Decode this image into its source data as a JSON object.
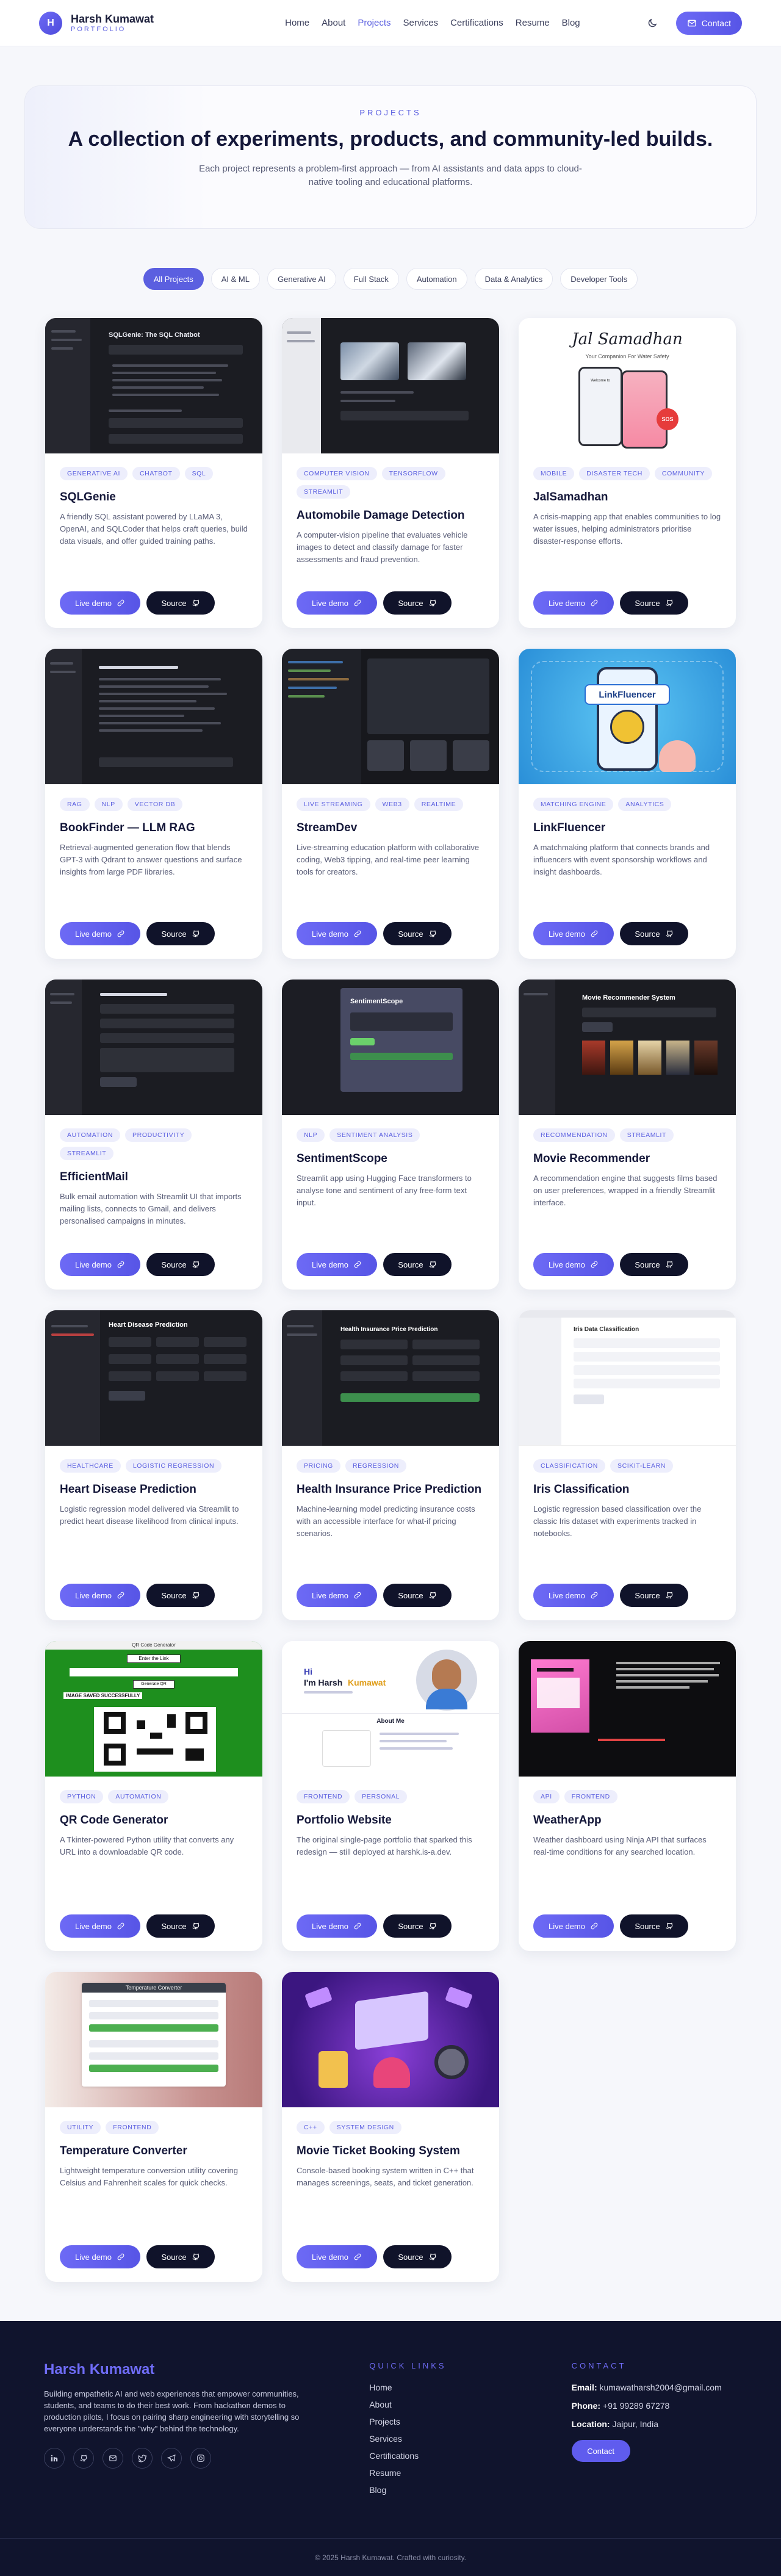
{
  "brand": {
    "logo": "H",
    "name": "Harsh Kumawat",
    "sub": "PORTFOLIO"
  },
  "nav": {
    "links": [
      "Home",
      "About",
      "Projects",
      "Services",
      "Certifications",
      "Resume",
      "Blog"
    ],
    "active": "Projects",
    "contact": "Contact"
  },
  "hero": {
    "eyebrow": "PROJECTS",
    "title": "A collection of experiments, products, and community-led builds.",
    "desc": "Each project represents a problem-first approach — from AI assistants and data apps to cloud-native tooling and educational platforms."
  },
  "filters": [
    "All Projects",
    "AI & ML",
    "Generative AI",
    "Full Stack",
    "Automation",
    "Data & Analytics",
    "Developer Tools"
  ],
  "buttons": {
    "live": "Live demo",
    "source": "Source"
  },
  "projects": [
    {
      "title": "SQLGenie",
      "tags": [
        "GENERATIVE AI",
        "CHATBOT",
        "SQL"
      ],
      "desc": "A friendly SQL assistant powered by LLaMA 3, OpenAI, and SQLCoder that helps craft queries, build data visuals, and offer guided training paths.",
      "thumb_text": "SQLGenie: The SQL Chatbot"
    },
    {
      "title": "Automobile Damage Detection",
      "tags": [
        "COMPUTER VISION",
        "TENSORFLOW",
        "STREAMLIT"
      ],
      "desc": "A computer-vision pipeline that evaluates vehicle images to detect and classify damage for faster assessments and fraud prevention."
    },
    {
      "title": "JalSamadhan",
      "tags": [
        "MOBILE",
        "DISASTER TECH",
        "COMMUNITY"
      ],
      "desc": "A crisis-mapping app that enables communities to log water issues, helping administrators prioritise disaster-response efforts.",
      "thumb_script": "Jal Samadhan",
      "thumb_sub": "Your Companion For Water Safety",
      "thumb_welcome": "Welcome to",
      "thumb_badge": "SOS"
    },
    {
      "title": "BookFinder — LLM RAG",
      "tags": [
        "RAG",
        "NLP",
        "VECTOR DB"
      ],
      "desc": "Retrieval-augmented generation flow that blends GPT-3 with Qdrant to answer questions and surface insights from large PDF libraries."
    },
    {
      "title": "StreamDev",
      "tags": [
        "LIVE STREAMING",
        "WEB3",
        "REALTIME"
      ],
      "desc": "Live-streaming education platform with collaborative coding, Web3 tipping, and real-time peer learning tools for creators."
    },
    {
      "title": "LinkFluencer",
      "tags": [
        "MATCHING ENGINE",
        "ANALYTICS"
      ],
      "desc": "A matchmaking platform that connects brands and influencers with event sponsorship workflows and insight dashboards.",
      "thumb_text": "LinkFluencer"
    },
    {
      "title": "EfficientMail",
      "tags": [
        "AUTOMATION",
        "PRODUCTIVITY",
        "STREAMLIT"
      ],
      "desc": "Bulk email automation with Streamlit UI that imports mailing lists, connects to Gmail, and delivers personalised campaigns in minutes."
    },
    {
      "title": "SentimentScope",
      "tags": [
        "NLP",
        "SENTIMENT ANALYSIS"
      ],
      "desc": "Streamlit app using Hugging Face transformers to analyse tone and sentiment of any free-form text input.",
      "thumb_text": "SentimentScope"
    },
    {
      "title": "Movie Recommender",
      "tags": [
        "RECOMMENDATION",
        "STREAMLIT"
      ],
      "desc": "A recommendation engine that suggests films based on user preferences, wrapped in a friendly Streamlit interface.",
      "thumb_text": "Movie Recommender System"
    },
    {
      "title": "Heart Disease Prediction",
      "tags": [
        "HEALTHCARE",
        "LOGISTIC REGRESSION"
      ],
      "desc": "Logistic regression model delivered via Streamlit to predict heart disease likelihood from clinical inputs.",
      "thumb_text": "Heart Disease Prediction"
    },
    {
      "title": "Health Insurance Price Prediction",
      "tags": [
        "PRICING",
        "REGRESSION"
      ],
      "desc": "Machine-learning model predicting insurance costs with an accessible interface for what-if pricing scenarios.",
      "thumb_text": "Health Insurance Price Prediction"
    },
    {
      "title": "Iris Classification",
      "tags": [
        "CLASSIFICATION",
        "SCIKIT-LEARN"
      ],
      "desc": "Logistic regression based classification over the classic Iris dataset with experiments tracked in notebooks.",
      "thumb_text": "Iris Data Classification"
    },
    {
      "title": "QR Code Generator",
      "tags": [
        "PYTHON",
        "AUTOMATION"
      ],
      "desc": "A Tkinter-powered Python utility that converts any URL into a downloadable QR code.",
      "thumb_top": "QR Code Generator",
      "thumb_enter": "Enter the Link",
      "thumb_generate": "Generate QR",
      "thumb_saved": "IMAGE SAVED SUCCESSFULLY"
    },
    {
      "title": "Portfolio Website",
      "tags": [
        "FRONTEND",
        "PERSONAL"
      ],
      "desc": "The original single-page portfolio that sparked this redesign — still deployed at harshk.is-a.dev.",
      "thumb_hi": "Hi",
      "thumb_im": "I'm Harsh",
      "thumb_last": "Kumawat",
      "thumb_about": "About Me"
    },
    {
      "title": "WeatherApp",
      "tags": [
        "API",
        "FRONTEND"
      ],
      "desc": "Weather dashboard using Ninja API that surfaces real-time conditions for any searched location."
    },
    {
      "title": "Temperature Converter",
      "tags": [
        "UTILITY",
        "FRONTEND"
      ],
      "desc": "Lightweight temperature conversion utility covering Celsius and Fahrenheit scales for quick checks.",
      "thumb_text": "Temperature Converter"
    },
    {
      "title": "Movie Ticket Booking System",
      "tags": [
        "C++",
        "SYSTEM DESIGN"
      ],
      "desc": "Console-based booking system written in C++ that manages screenings, seats, and ticket generation."
    }
  ],
  "footer": {
    "name": "Harsh Kumawat",
    "text": "Building empathetic AI and web experiences that empower communities, students, and teams to do their best work. From hackathon demos to production pilots, I focus on pairing sharp engineering with storytelling so everyone understands the \"why\" behind the technology.",
    "quick_head": "QUICK LINKS",
    "quick_links": [
      "Home",
      "About",
      "Projects",
      "Services",
      "Certifications",
      "Resume",
      "Blog"
    ],
    "contact_head": "CONTACT",
    "email_label": "Email:",
    "email": "kumawatharsh2004@gmail.com",
    "phone_label": "Phone:",
    "phone": "+91 99289 67278",
    "location_label": "Location:",
    "location": "Jaipur, India",
    "contact_btn": "Contact",
    "copyright": "© 2025 Harsh Kumawat. Crafted with curiosity."
  }
}
